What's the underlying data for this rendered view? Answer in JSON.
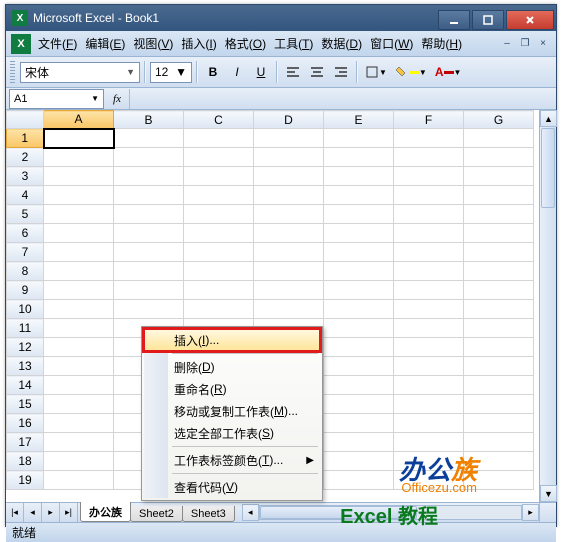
{
  "titlebar": {
    "app": "Microsoft Excel",
    "doc": "Book1"
  },
  "menus": [
    {
      "label": "文件",
      "key": "F"
    },
    {
      "label": "编辑",
      "key": "E"
    },
    {
      "label": "视图",
      "key": "V"
    },
    {
      "label": "插入",
      "key": "I"
    },
    {
      "label": "格式",
      "key": "O"
    },
    {
      "label": "工具",
      "key": "T"
    },
    {
      "label": "数据",
      "key": "D"
    },
    {
      "label": "窗口",
      "key": "W"
    },
    {
      "label": "帮助",
      "key": "H"
    }
  ],
  "toolbar": {
    "font": "宋体",
    "size": "12"
  },
  "namebox": "A1",
  "grid": {
    "columns": [
      "A",
      "B",
      "C",
      "D",
      "E",
      "F",
      "G"
    ],
    "rows": [
      1,
      2,
      3,
      4,
      5,
      6,
      7,
      8,
      9,
      10,
      11,
      12,
      13,
      14,
      15,
      16,
      17,
      18,
      19
    ],
    "active": {
      "row": 1,
      "col": "A"
    }
  },
  "sheet_tabs": {
    "active": "办公族",
    "others": [
      "Sheet2",
      "Sheet3"
    ]
  },
  "status": "就绪",
  "context_menu": [
    {
      "label": "插入",
      "key": "I",
      "highlight": true,
      "ellipsis": true
    },
    {
      "sep": true
    },
    {
      "label": "删除",
      "key": "D"
    },
    {
      "label": "重命名",
      "key": "R"
    },
    {
      "label": "移动或复制工作表",
      "key": "M",
      "ellipsis": true
    },
    {
      "label": "选定全部工作表",
      "key": "S"
    },
    {
      "sep": true
    },
    {
      "label": "工作表标签颜色",
      "key": "T",
      "ellipsis": true,
      "submenu": true
    },
    {
      "sep": true
    },
    {
      "label": "查看代码",
      "key": "V"
    }
  ],
  "watermark": {
    "brand_a": "办公",
    "brand_b": "族",
    "url": "Officezu.com",
    "tag": "Excel 教程"
  }
}
